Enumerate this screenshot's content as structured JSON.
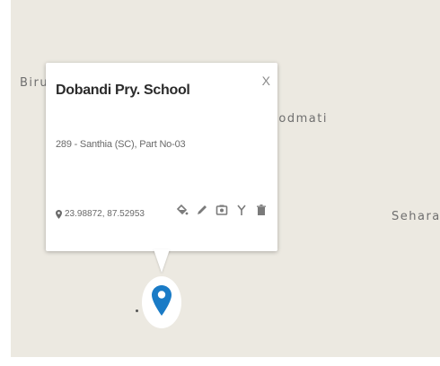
{
  "map": {
    "place_labels": [
      "Biru",
      "Bodmati",
      "Sehara"
    ]
  },
  "popup": {
    "title": "Dobandi Pry. School",
    "subtitle": "289 - Santhia (SC), Part No-03",
    "coordinates": "23.98872, 87.52953",
    "close_label": "X",
    "actions": [
      "paint-bucket-icon",
      "pencil-icon",
      "camera-icon",
      "fork-icon",
      "trash-icon"
    ]
  },
  "colors": {
    "map_background": "#ece9e1",
    "marker": "#1a7bc6",
    "icon": "#7a7a7a"
  }
}
